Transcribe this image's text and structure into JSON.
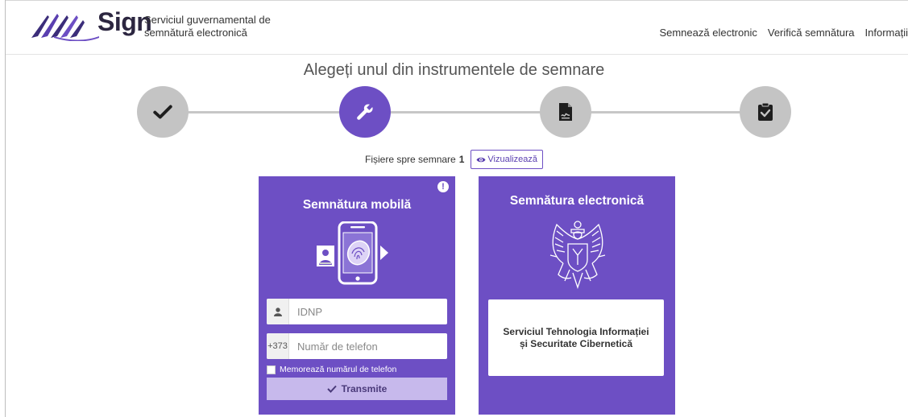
{
  "header": {
    "brand": "Sign",
    "tagline_line1": "Serviciul guvernamental de",
    "tagline_line2": "semnătură electronică",
    "nav": [
      "Semnează electronic",
      "Verifică semnătura",
      "Informații"
    ]
  },
  "main": {
    "title": "Alegeți unul din instrumentele de semnare",
    "steps": [
      {
        "icon": "check-icon",
        "state": "done"
      },
      {
        "icon": "wrench-icon",
        "state": "active"
      },
      {
        "icon": "signed-document-icon",
        "state": "pending"
      },
      {
        "icon": "clipboard-check-icon",
        "state": "pending"
      }
    ],
    "files_label": "Fișiere spre semnare",
    "files_count": "1",
    "view_label": "Vizualizează"
  },
  "mobile_card": {
    "title": "Semnătura mobilă",
    "idnp_placeholder": "IDNP",
    "phone_prefix": "+373",
    "phone_placeholder": "Număr de telefon",
    "remember_label": "Memorează numărul de telefon",
    "submit_label": "Transmite"
  },
  "electronic_card": {
    "title": "Semnătura electronică",
    "org_name": "Serviciul Tehnologia Informației și Securitate Cibernetică"
  },
  "colors": {
    "accent": "#6d4fc4",
    "step_inactive": "#c4c4c4"
  }
}
